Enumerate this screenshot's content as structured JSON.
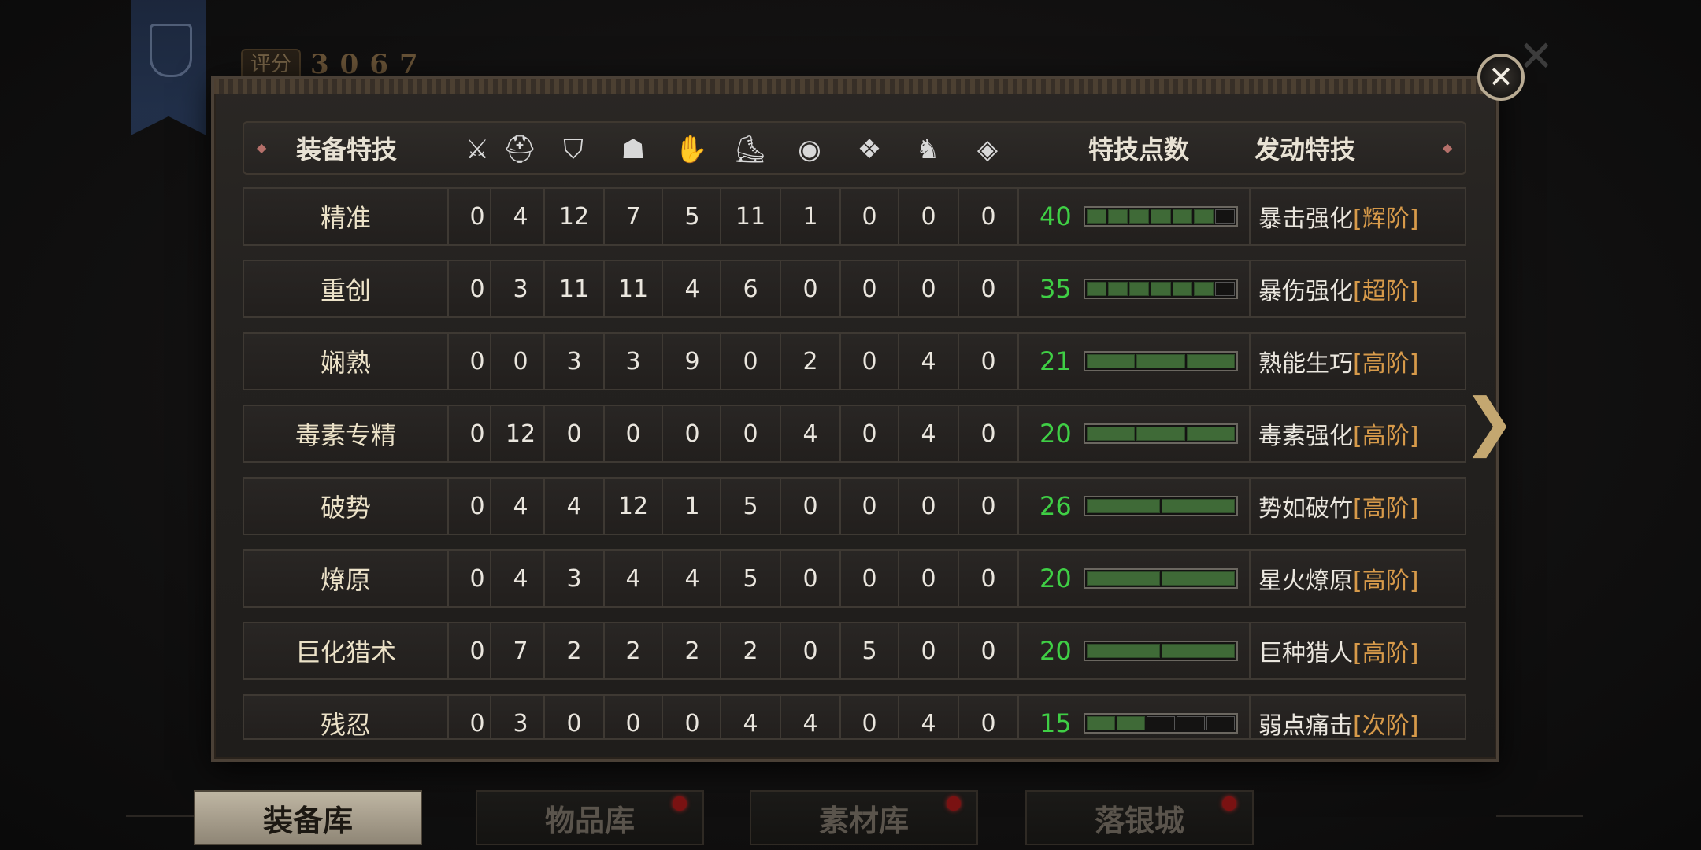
{
  "score": {
    "label": "评分",
    "value": "3067"
  },
  "close_label": "✕",
  "header": {
    "title": "装备特技",
    "points": "特技点数",
    "skill": "发动特技",
    "icons": [
      "sword-icon",
      "helmet-icon",
      "chest-armor-icon",
      "shoulder-icon",
      "glove-icon",
      "boot-icon",
      "charm-icon",
      "pendant-icon",
      "knight-icon",
      "gem-icon"
    ]
  },
  "rows": [
    {
      "name": "精准",
      "vals": [
        "0",
        "4",
        "12",
        "7",
        "5",
        "11",
        "1",
        "0",
        "0",
        "0"
      ],
      "points": "40",
      "filled": 6,
      "segs": 7,
      "skill": "暴击强化",
      "tier": "[辉阶]"
    },
    {
      "name": "重创",
      "vals": [
        "0",
        "3",
        "11",
        "11",
        "4",
        "6",
        "0",
        "0",
        "0",
        "0"
      ],
      "points": "35",
      "filled": 6,
      "segs": 7,
      "skill": "暴伤强化",
      "tier": "[超阶]"
    },
    {
      "name": "娴熟",
      "vals": [
        "0",
        "0",
        "3",
        "3",
        "9",
        "0",
        "2",
        "0",
        "4",
        "0"
      ],
      "points": "21",
      "filled": 3,
      "segs": 3,
      "skill": "熟能生巧",
      "tier": "[高阶]"
    },
    {
      "name": "毒素专精",
      "vals": [
        "0",
        "12",
        "0",
        "0",
        "0",
        "0",
        "4",
        "0",
        "4",
        "0"
      ],
      "points": "20",
      "filled": 3,
      "segs": 3,
      "skill": "毒素强化",
      "tier": "[高阶]"
    },
    {
      "name": "破势",
      "vals": [
        "0",
        "4",
        "4",
        "12",
        "1",
        "5",
        "0",
        "0",
        "0",
        "0"
      ],
      "points": "26",
      "filled": 2,
      "segs": 2,
      "skill": "势如破竹",
      "tier": "[高阶]"
    },
    {
      "name": "燎原",
      "vals": [
        "0",
        "4",
        "3",
        "4",
        "4",
        "5",
        "0",
        "0",
        "0",
        "0"
      ],
      "points": "20",
      "filled": 2,
      "segs": 2,
      "skill": "星火燎原",
      "tier": "[高阶]"
    },
    {
      "name": "巨化猎术",
      "vals": [
        "0",
        "7",
        "2",
        "2",
        "2",
        "2",
        "0",
        "5",
        "0",
        "0"
      ],
      "points": "20",
      "filled": 2,
      "segs": 2,
      "skill": "巨种猎人",
      "tier": "[高阶]"
    },
    {
      "name": "残忍",
      "vals": [
        "0",
        "3",
        "0",
        "0",
        "0",
        "4",
        "4",
        "0",
        "4",
        "0"
      ],
      "points": "15",
      "filled": 2,
      "segs": 5,
      "skill": "弱点痛击",
      "tier": "[次阶]"
    }
  ],
  "tabs": [
    {
      "label": "装备库",
      "active": true
    },
    {
      "label": "物品库",
      "active": false
    },
    {
      "label": "素材库",
      "active": false
    },
    {
      "label": "落银城",
      "active": false
    }
  ]
}
